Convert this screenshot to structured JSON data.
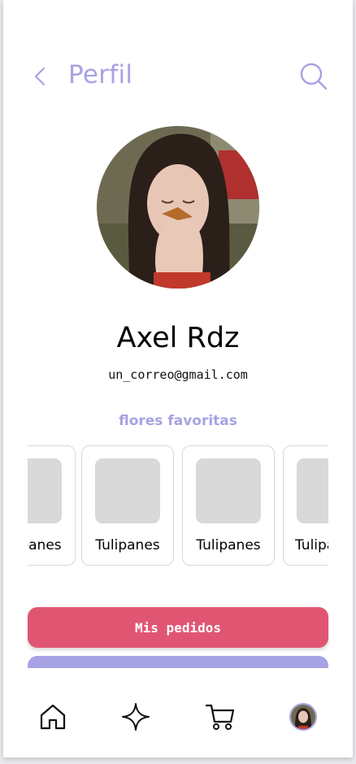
{
  "header": {
    "title": "Perfil",
    "back_icon": "chevron-left-icon",
    "search_icon": "search-icon",
    "accent": "#a7a2e3"
  },
  "profile": {
    "avatar": "profile-photo",
    "name": "Axel Rdz",
    "email": "un_correo@gmail.com"
  },
  "favorites": {
    "title": "flores favoritas",
    "items": [
      {
        "label": "Tulipanes"
      },
      {
        "label": "Tulipanes"
      },
      {
        "label": "Tulipanes"
      },
      {
        "label": "Tulipanes"
      }
    ]
  },
  "actions": {
    "orders_label": "Mis pedidos",
    "orders_color": "#e05672",
    "secondary_color": "#a7a2e3"
  },
  "tabbar": {
    "items": [
      {
        "icon": "home-icon"
      },
      {
        "icon": "sparkle-icon"
      },
      {
        "icon": "cart-icon"
      },
      {
        "icon": "profile-avatar"
      }
    ]
  }
}
